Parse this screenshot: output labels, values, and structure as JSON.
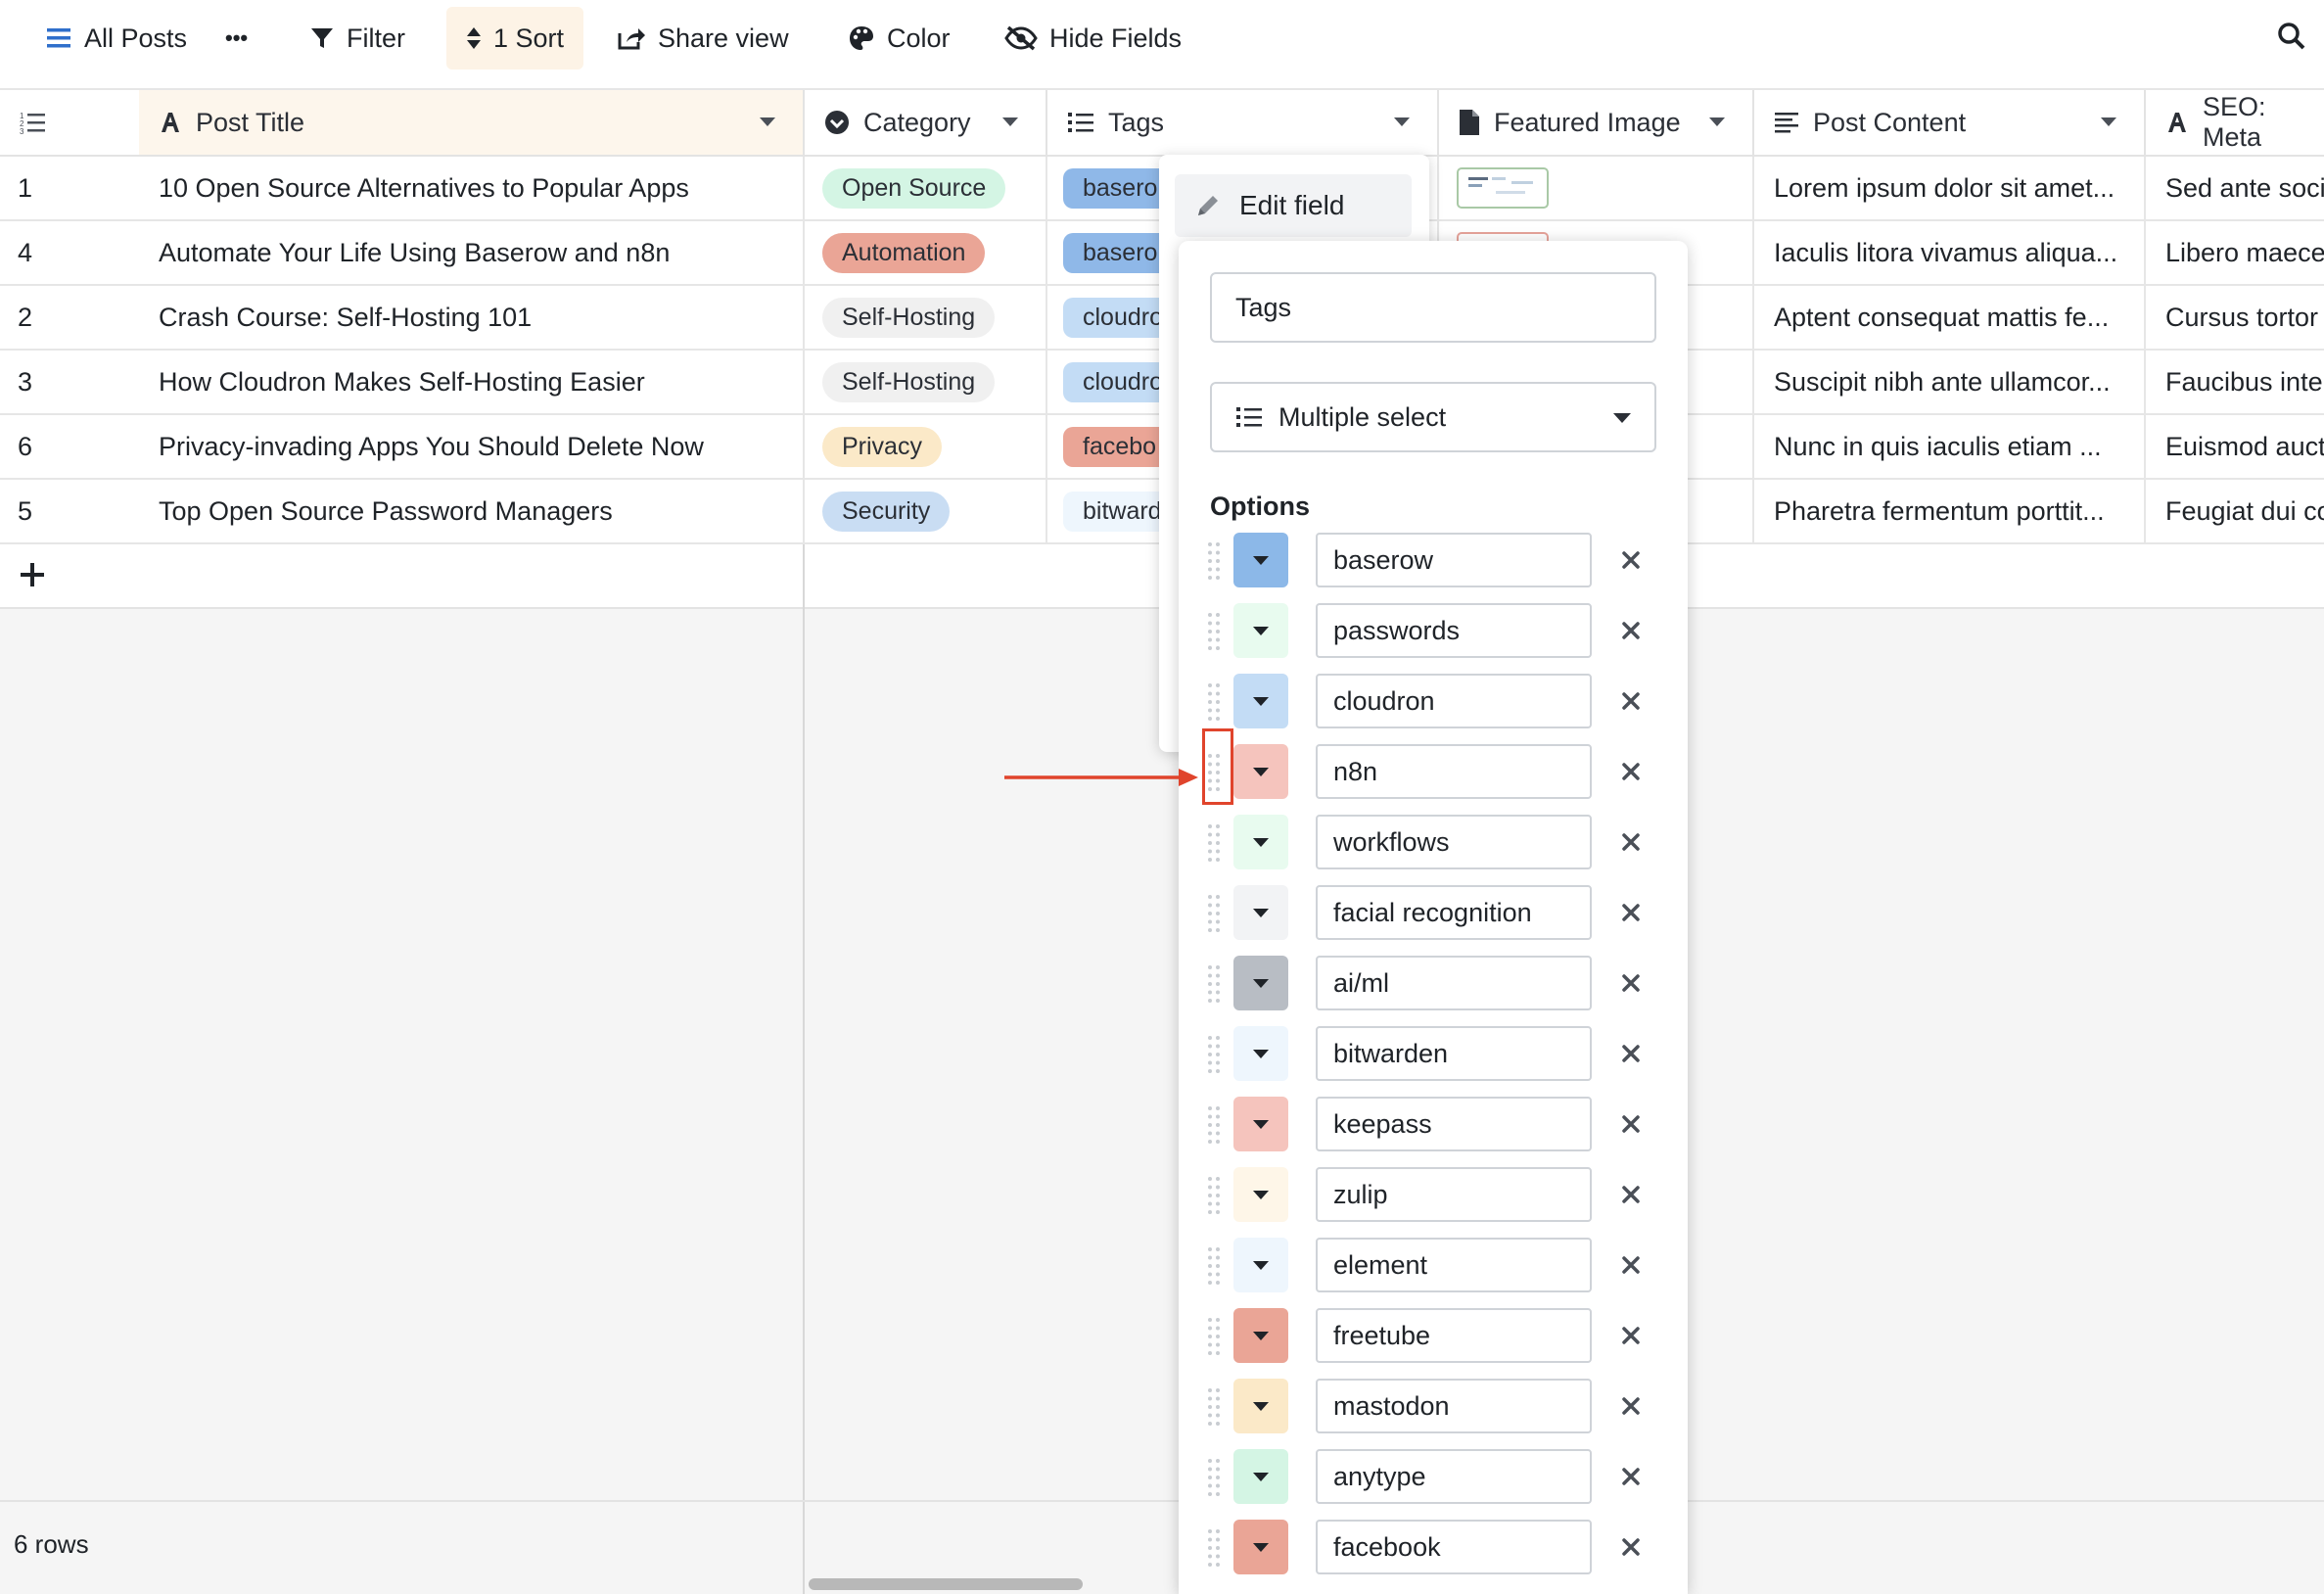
{
  "toolbar": {
    "view_name": "All Posts",
    "more_label": "•••",
    "filter_label": "Filter",
    "sort_label": "1 Sort",
    "share_label": "Share view",
    "color_label": "Color",
    "hide_label": "Hide Fields"
  },
  "columns": [
    "Post Title",
    "Category",
    "Tags",
    "Featured Image",
    "Post Content",
    "SEO: Meta"
  ],
  "rows": [
    {
      "id": "1",
      "title": "10 Open Source Alternatives to Popular Apps",
      "category": "Open Source",
      "category_color": "#d4f5e4",
      "tag": "basero",
      "tag_color": "#8fb8e8",
      "content": "Lorem ipsum dolor sit amet...",
      "seo": "Sed ante soci"
    },
    {
      "id": "4",
      "title": "Automate Your Life Using Baserow and n8n",
      "category": "Automation",
      "category_color": "#eaa596",
      "tag": "basero",
      "tag_color": "#8fb8e8",
      "content": "Iaculis litora vivamus aliqua...",
      "seo": "Libero maece"
    },
    {
      "id": "2",
      "title": "Crash Course: Self-Hosting 101",
      "category": "Self-Hosting",
      "category_color": "#f0f0f0",
      "tag": "cloudro",
      "tag_color": "#c3dcf5",
      "content": "Aptent consequat mattis fe...",
      "seo": "Cursus tortor"
    },
    {
      "id": "3",
      "title": "How Cloudron Makes Self-Hosting Easier",
      "category": "Self-Hosting",
      "category_color": "#f0f0f0",
      "tag": "cloudro",
      "tag_color": "#c3dcf5",
      "content": "Suscipit nibh ante ullamcor...",
      "seo": "Faucibus inte"
    },
    {
      "id": "6",
      "title": "Privacy-invading Apps You Should Delete Now",
      "category": "Privacy",
      "category_color": "#fbe9c8",
      "tag": "facebo",
      "tag_color": "#eaa596",
      "content": "Nunc in quis iaculis etiam ...",
      "seo": "Euismod auct"
    },
    {
      "id": "5",
      "title": "Top Open Source Password Managers",
      "category": "Security",
      "category_color": "#c9ddf3",
      "tag": "bitward",
      "tag_color": "#eef6fd",
      "content": "Pharetra fermentum porttit...",
      "seo": "Feugiat dui co"
    }
  ],
  "footer": {
    "row_count": "6 rows"
  },
  "context_menu": {
    "edit_field": "Edit field"
  },
  "field_editor": {
    "field_name": "Tags",
    "field_type": "Multiple select",
    "options_label": "Options",
    "options": [
      {
        "label": "baserow",
        "color": "#8cb8e8"
      },
      {
        "label": "passwords",
        "color": "#e8fbef"
      },
      {
        "label": "cloudron",
        "color": "#c3dcf5"
      },
      {
        "label": "n8n",
        "color": "#f5c4bd"
      },
      {
        "label": "workflows",
        "color": "#e8fbef"
      },
      {
        "label": "facial recognition",
        "color": "#f2f3f5"
      },
      {
        "label": "ai/ml",
        "color": "#b8bdc4"
      },
      {
        "label": "bitwarden",
        "color": "#eef6fd"
      },
      {
        "label": "keepass",
        "color": "#f5c4bd"
      },
      {
        "label": "zulip",
        "color": "#fef6e8"
      },
      {
        "label": "element",
        "color": "#eef6fd"
      },
      {
        "label": "freetube",
        "color": "#eaa596"
      },
      {
        "label": "mastodon",
        "color": "#fbe9c8"
      },
      {
        "label": "anytype",
        "color": "#d4f5e4"
      },
      {
        "label": "facebook",
        "color": "#eaa596"
      }
    ]
  }
}
